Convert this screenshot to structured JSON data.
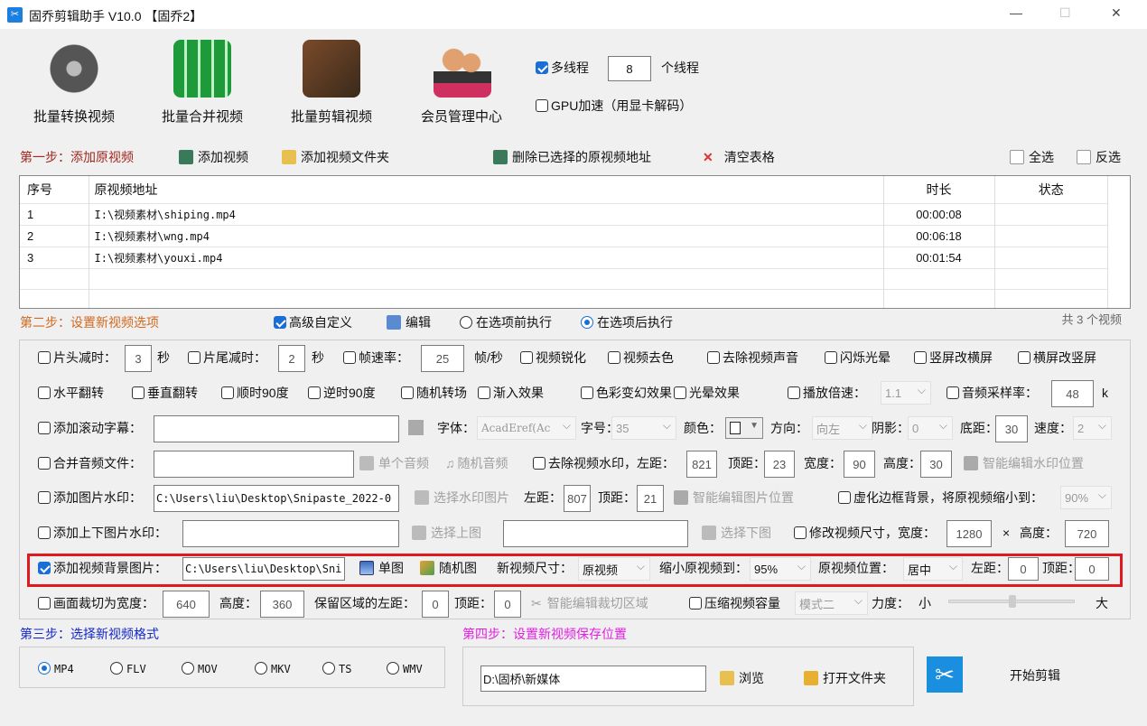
{
  "window": {
    "title": "固乔剪辑助手 V10.0 【固乔2】",
    "min": "—",
    "max": "☐",
    "close": "✕"
  },
  "toolbar": {
    "buttons": [
      "批量转换视频",
      "批量合并视频",
      "批量剪辑视频",
      "会员管理中心"
    ],
    "multithread_label": "多线程",
    "multithread_checked": true,
    "threads": "8",
    "threads_unit": "个线程",
    "gpu_label": "GPU加速（用显卡解码）",
    "gpu_checked": false
  },
  "step1": {
    "title": "第一步：添加原视频",
    "add_video": "添加视频",
    "add_folder": "添加视频文件夹",
    "delete_selected": "删除已选择的原视频地址",
    "clear_table": "清空表格",
    "select_all": "全选",
    "invert": "反选"
  },
  "table": {
    "columns": [
      "序号",
      "原视频地址",
      "时长",
      "状态"
    ],
    "rows": [
      [
        "1",
        "I:\\视频素材\\shiping.mp4",
        "00:00:08",
        ""
      ],
      [
        "2",
        "I:\\视频素材\\wng.mp4",
        "00:06:18",
        ""
      ],
      [
        "3",
        "I:\\视频素材\\youxi.mp4",
        "00:01:54",
        ""
      ]
    ]
  },
  "step2": {
    "title": "第二步：设置新视频选项",
    "advanced": "高级自定义",
    "advanced_checked": true,
    "edit": "编辑",
    "before": "在选项前执行",
    "after": "在选项后执行",
    "selected_mode": "after",
    "count": "共 3 个视频"
  },
  "opts": {
    "r1": {
      "head_cut": "片头减时：",
      "head_val": "3",
      "sec": "秒",
      "tail_cut": "片尾减时：",
      "tail_val": "2",
      "fps": "帧速率：",
      "fps_val": "25",
      "fps_unit": "帧/秒",
      "sharpen": "视频锐化",
      "decolor": "视频去色",
      "mute": "去除视频声音",
      "flash": "闪烁光晕",
      "v2h": "竖屏改横屏",
      "h2v": "横屏改竖屏"
    },
    "r2": {
      "hflip": "水平翻转",
      "vflip": "垂直翻转",
      "cw90": "顺时90度",
      "ccw90": "逆时90度",
      "trans": "随机转场",
      "fadein": "渐入效果",
      "color": "色彩变幻效果",
      "halo": "光晕效果",
      "speed": "播放倍速：",
      "speed_val": "1.1",
      "sr": "音频采样率：",
      "sr_val": "48",
      "sr_unit": "k"
    },
    "r3": {
      "scroll": "添加滚动字幕：",
      "font": "字体：",
      "font_val": "AcadEref(Ac",
      "size": "字号：",
      "size_val": "35",
      "color": "颜色：",
      "dir": "方向：",
      "dir_val": "向左",
      "shadow": "阴影：",
      "shadow_val": "0",
      "bottom": "底距：",
      "bottom_val": "30",
      "spd": "速度：",
      "spd_val": "2"
    },
    "r4": {
      "audio": "合并音频文件：",
      "single": "单个音频",
      "random": "随机音频",
      "rmwm": "去除视频水印，左距：",
      "left_val": "821",
      "top": "顶距：",
      "top_val": "23",
      "w": "宽度：",
      "w_val": "90",
      "h": "高度：",
      "h_val": "30",
      "smart": "智能编辑水印位置"
    },
    "r5": {
      "imgwm": "添加图片水印：",
      "path": "C:\\Users\\liu\\Desktop\\Snipaste_2022-0",
      "choose": "选择水印图片",
      "left": "左距：",
      "left_val": "807",
      "top": "顶距：",
      "top_val": "21",
      "smart": "智能编辑图片位置",
      "blur": "虚化边框背景，将原视频缩小到：",
      "blur_val": "90%"
    },
    "r6": {
      "tb": "添加上下图片水印：",
      "up": "选择上图",
      "down": "选择下图",
      "resize": "修改视频尺寸，宽度：",
      "w_val": "1280",
      "x": "×",
      "h": "高度：",
      "h_val": "720"
    },
    "r7": {
      "bg": "添加视频背景图片：",
      "bg_checked": true,
      "path": "C:\\Users\\liu\\Desktop\\Sni",
      "single": "单图",
      "random": "随机图",
      "size": "新视频尺寸：",
      "size_val": "原视频",
      "shrink": "缩小原视频到：",
      "shrink_val": "95%",
      "pos": "原视频位置：",
      "pos_val": "居中",
      "left": "左距：",
      "left_val": "0",
      "top": "顶距：",
      "top_val": "0"
    },
    "r8": {
      "crop": "画面裁切为宽度：",
      "w_val": "640",
      "h": "高度：",
      "h_val": "360",
      "keep": "保留区域的左距：",
      "left_val": "0",
      "top": "顶距：",
      "top_val": "0",
      "smart": "智能编辑裁切区域",
      "compress": "压缩视频容量",
      "mode_val": "模式二",
      "force": "力度：",
      "small": "小",
      "large": "大",
      "force_level": 0.5
    }
  },
  "step3": {
    "title": "第三步：选择新视频格式",
    "formats": [
      "MP4",
      "FLV",
      "MOV",
      "MKV",
      "TS",
      "WMV"
    ],
    "selected": "MP4"
  },
  "step4": {
    "title": "第四步：设置新视频保存位置",
    "path": "D:\\固桥\\新媒体",
    "browse": "浏览",
    "open": "打开文件夹",
    "start": "开始剪辑"
  },
  "colors": {
    "step1": "#a0281e",
    "step2": "#d2691e",
    "step3": "#1428c8",
    "step4": "#e020e0",
    "highlight": "#e0191e",
    "accent": "#1a6fd6"
  }
}
